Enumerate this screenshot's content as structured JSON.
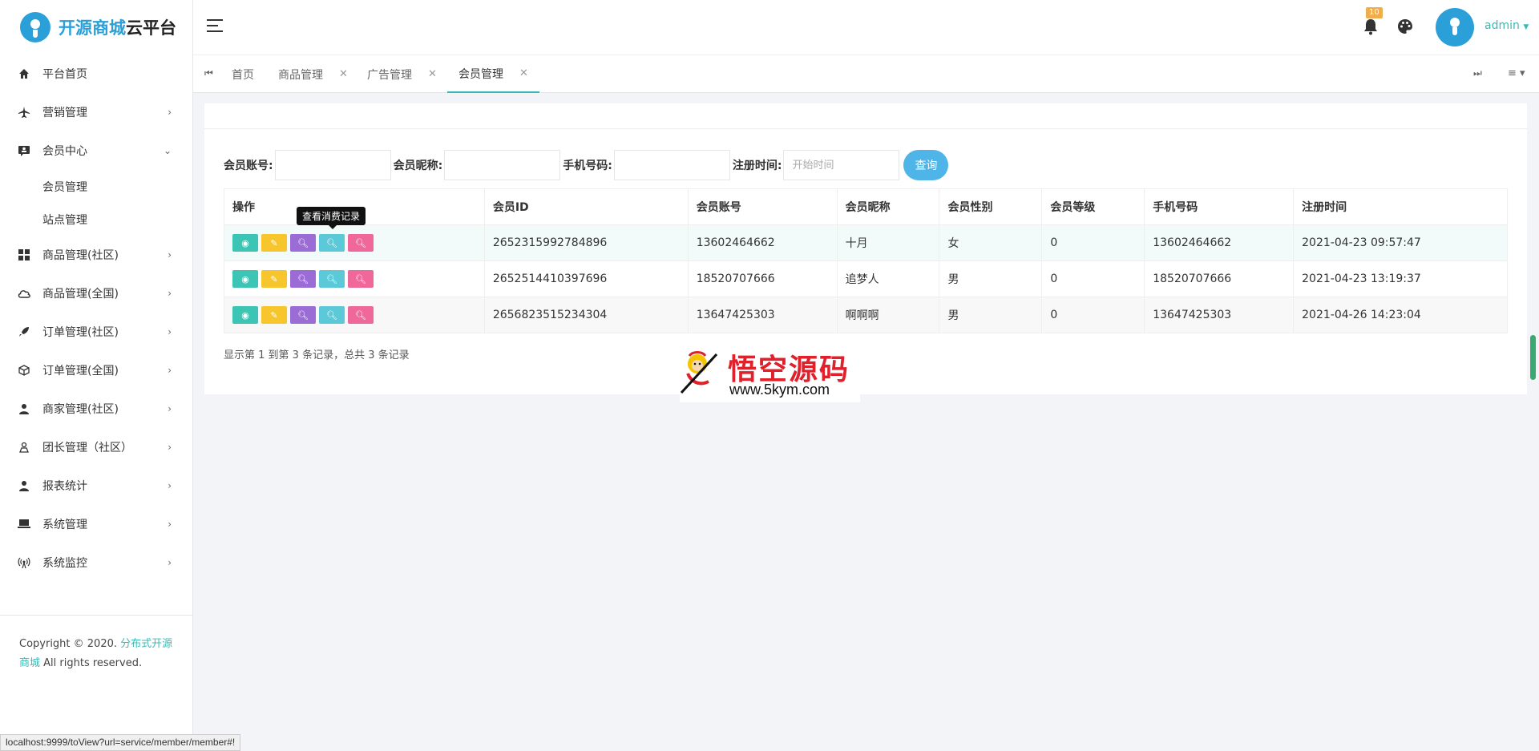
{
  "brand": {
    "name_part1": "开源商城",
    "name_part2": "云平台"
  },
  "sidebar": {
    "items": [
      {
        "label": "平台首页",
        "icon": "home-icon"
      },
      {
        "label": "营销管理",
        "icon": "airplane-icon"
      },
      {
        "label": "会员中心",
        "icon": "member-icon",
        "expanded": true,
        "children": [
          {
            "label": "会员管理"
          },
          {
            "label": "站点管理"
          }
        ]
      },
      {
        "label": "商品管理(社区)",
        "icon": "grid-icon"
      },
      {
        "label": "商品管理(全国)",
        "icon": "cloud-icon"
      },
      {
        "label": "订单管理(社区)",
        "icon": "rocket-icon"
      },
      {
        "label": "订单管理(全国)",
        "icon": "box-icon"
      },
      {
        "label": "商家管理(社区)",
        "icon": "user-icon"
      },
      {
        "label": "团长管理（社区）",
        "icon": "leader-icon"
      },
      {
        "label": "报表统计",
        "icon": "report-icon"
      },
      {
        "label": "系统管理",
        "icon": "laptop-icon"
      },
      {
        "label": "系统监控",
        "icon": "broadcast-icon"
      }
    ],
    "copyright": {
      "prefix": "Copyright © 2020. ",
      "link": "分布式开源商城",
      "suffix": " All rights reserved."
    }
  },
  "header": {
    "notification_count": "10",
    "user_name": "admin"
  },
  "tabs": [
    {
      "label": "首页",
      "closable": false
    },
    {
      "label": "商品管理",
      "closable": true
    },
    {
      "label": "广告管理",
      "closable": true
    },
    {
      "label": "会员管理",
      "closable": true,
      "active": true
    }
  ],
  "search": {
    "account_label": "会员账号:",
    "nickname_label": "会员昵称:",
    "phone_label": "手机号码:",
    "reg_time_label": "注册时间:",
    "reg_time_placeholder": "开始时间",
    "submit_label": "查询"
  },
  "table": {
    "columns": [
      "操作",
      "会员ID",
      "会员账号",
      "会员昵称",
      "会员性别",
      "会员等级",
      "手机号码",
      "注册时间"
    ],
    "rows": [
      {
        "id": "2652315992784896",
        "account": "13602464662",
        "nickname": "十月",
        "gender": "女",
        "level": "0",
        "phone": "13602464662",
        "reg_time": "2021-04-23 09:57:47"
      },
      {
        "id": "2652514410397696",
        "account": "18520707666",
        "nickname": "追梦人",
        "gender": "男",
        "level": "0",
        "phone": "18520707666",
        "reg_time": "2021-04-23 13:19:37"
      },
      {
        "id": "2656823515234304",
        "account": "13647425303",
        "nickname": "啊啊啊",
        "gender": "男",
        "level": "0",
        "phone": "13647425303",
        "reg_time": "2021-04-26 14:23:04"
      }
    ]
  },
  "tooltip": "查看消费记录",
  "pagination_info": "显示第 1 到第 3 条记录，总共 3 条记录",
  "watermark": {
    "title": "悟空源码",
    "url": "www.5kym.com"
  },
  "status_url": "localhost:9999/toView?url=service/member/member#!",
  "colors": {
    "accent": "#3cb9b4",
    "brand": "#2a9fd8",
    "search_button": "#4fb4e8"
  }
}
